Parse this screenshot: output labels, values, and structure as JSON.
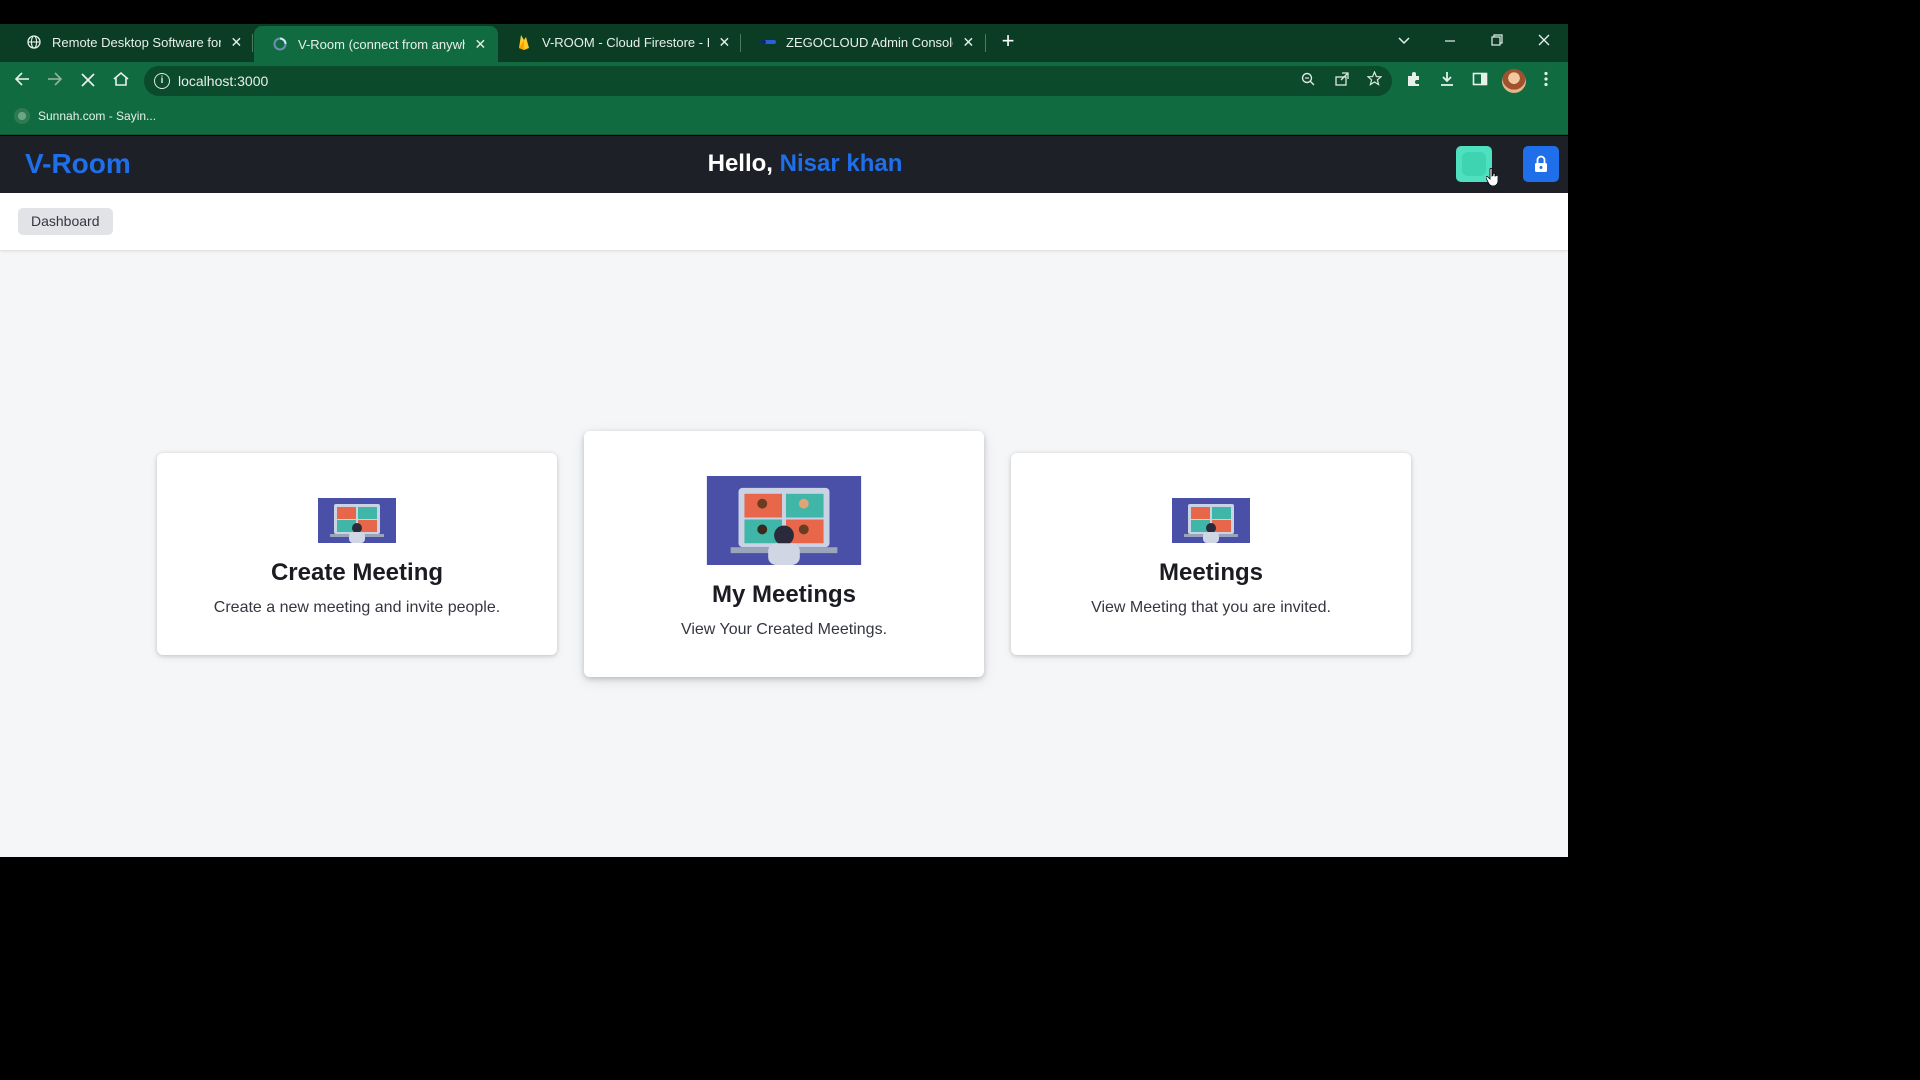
{
  "browser": {
    "tabs": [
      {
        "title": "Remote Desktop Software for Wi",
        "favicon": "globe-icon"
      },
      {
        "title": "V-Room (connect from anywhere",
        "favicon": "loading-spinner-icon"
      },
      {
        "title": "V-ROOM - Cloud Firestore - Fire",
        "favicon": "firebase-icon"
      },
      {
        "title": "ZEGOCLOUD Admin Console - O",
        "favicon": "zegocloud-icon"
      }
    ],
    "active_tab_index": 1,
    "url": "localhost:3000",
    "bookmarks": [
      {
        "label": "Sunnah.com - Sayin...",
        "icon": "sunnah-icon"
      }
    ]
  },
  "app": {
    "brand": "V-Room",
    "greeting_prefix": "Hello, ",
    "user_name": "Nisar khan",
    "breadcrumb": "Dashboard",
    "colors": {
      "accent": "#1f6feb",
      "header_bg": "#1d2026",
      "avatar": "#4fe0c0"
    },
    "cards": [
      {
        "title": "Create Meeting",
        "description": "Create a new meeting and invite people."
      },
      {
        "title": "My Meetings",
        "description": "View Your Created Meetings."
      },
      {
        "title": "Meetings",
        "description": "View Meeting that you are invited."
      }
    ]
  }
}
